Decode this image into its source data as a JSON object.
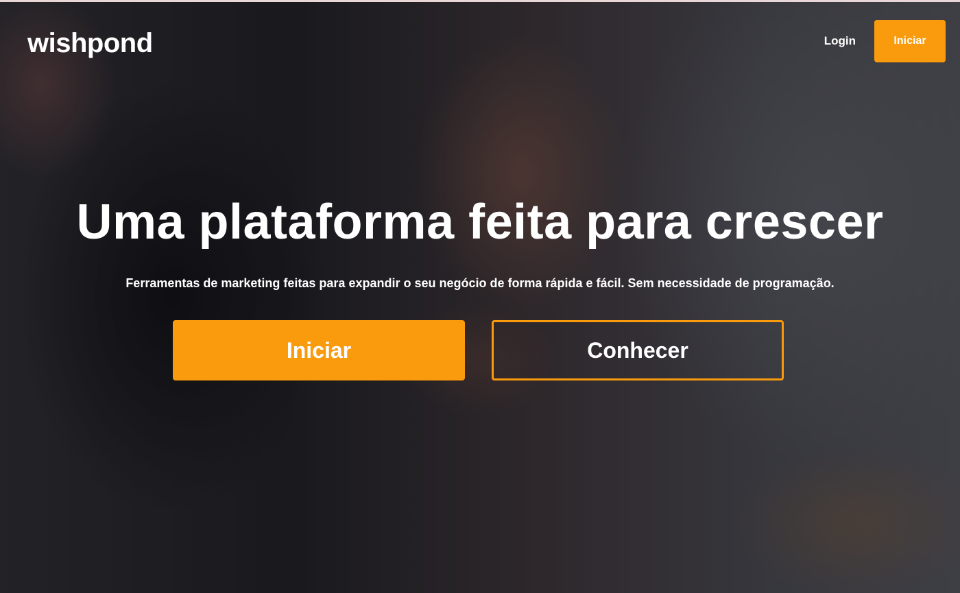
{
  "header": {
    "logo": "wishpond",
    "login_label": "Login",
    "cta_label": "Iniciar"
  },
  "hero": {
    "headline": "Uma plataforma feita para crescer",
    "subheadline": "Ferramentas de marketing feitas para expandir o seu negócio de forma rápida e fácil. Sem necessidade de programação.",
    "primary_cta": "Iniciar",
    "secondary_cta": "Conhecer"
  },
  "colors": {
    "accent": "#f99b0c",
    "text": "#ffffff"
  }
}
